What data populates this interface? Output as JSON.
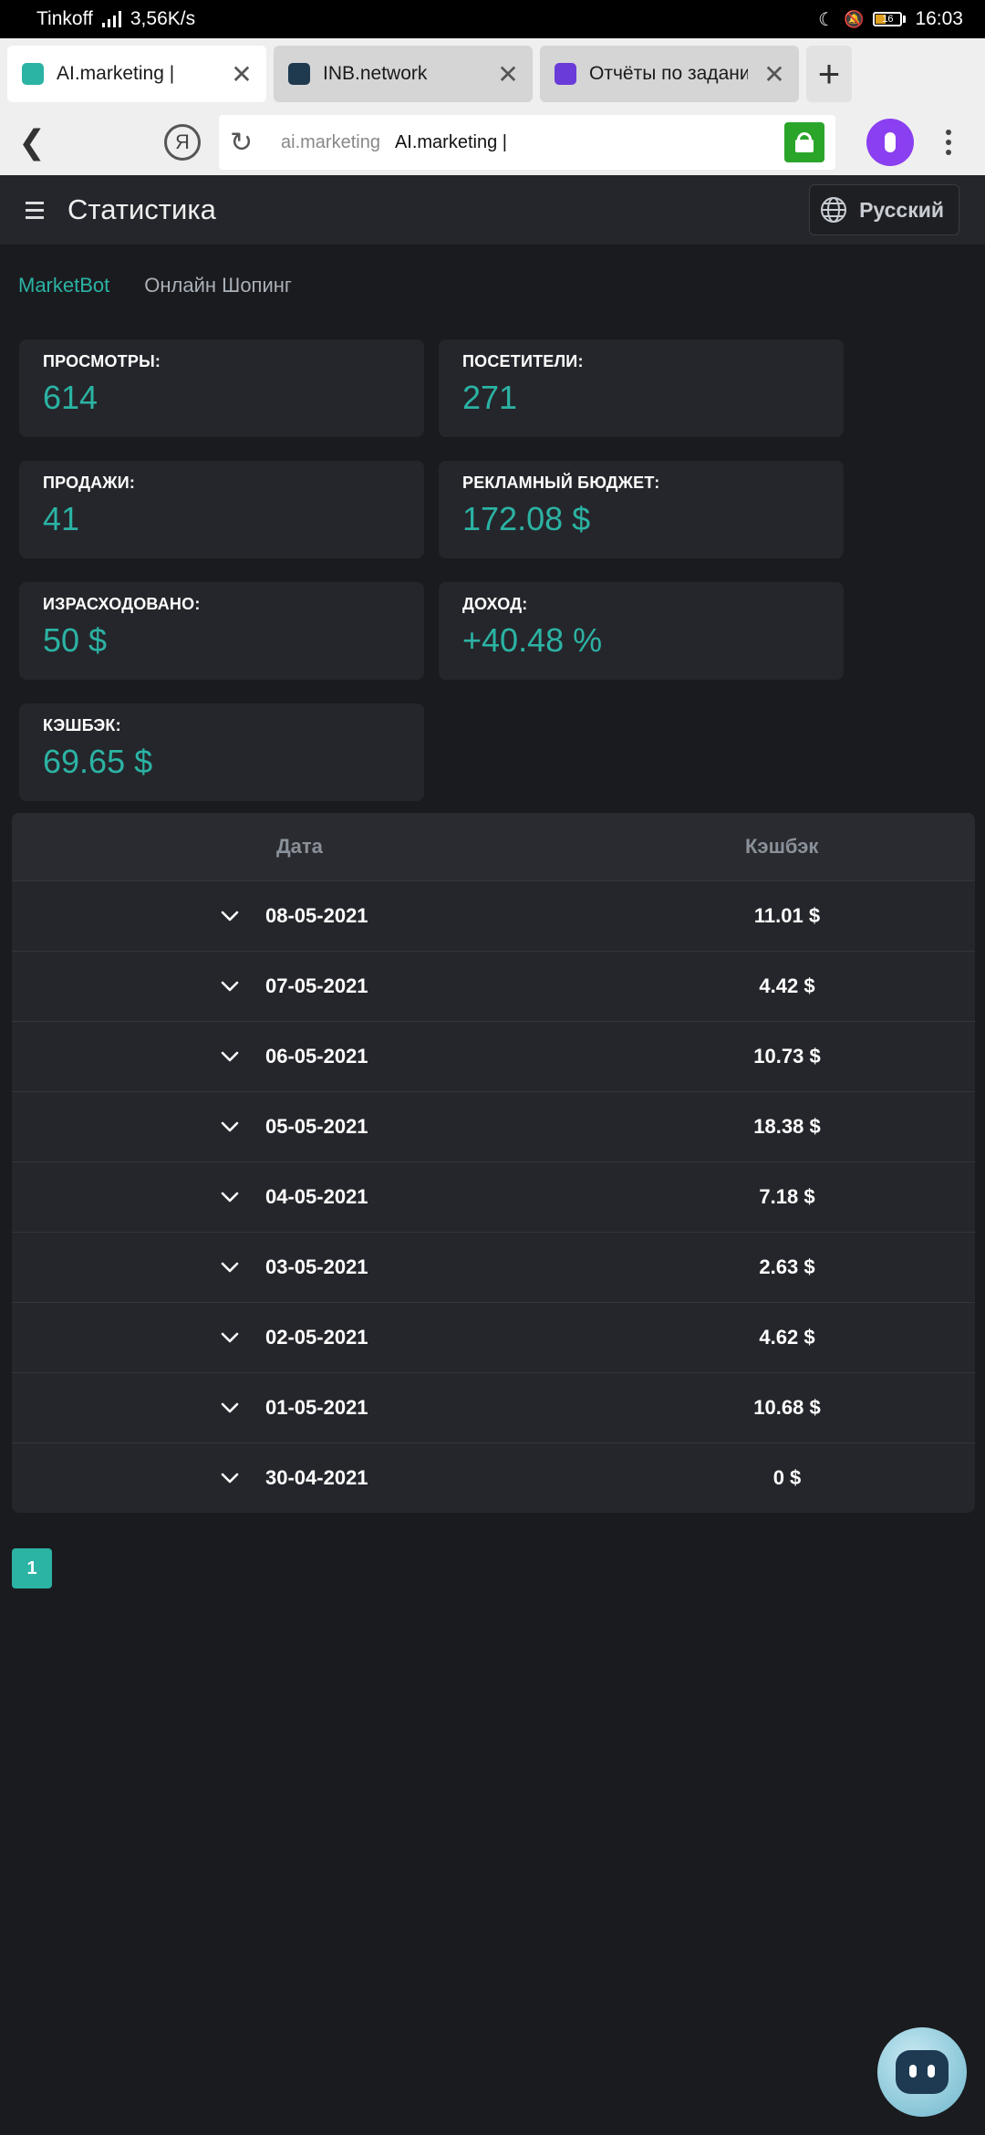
{
  "status_bar": {
    "carrier": "Tinkoff",
    "speed": "3,56K/s",
    "battery": "16",
    "time": "16:03"
  },
  "tabs": [
    {
      "title": "AI.marketing |",
      "favicon_color": "#2bb3a4"
    },
    {
      "title": "INB.network",
      "favicon_color": "#1f3a4f"
    },
    {
      "title": "Отчёты по задания",
      "favicon_color": "#6a3bd8"
    }
  ],
  "address_bar": {
    "logo": "Я",
    "domain": "ai.marketing",
    "page_title": "AI.marketing |"
  },
  "header": {
    "title": "Статистика",
    "language": "Русский"
  },
  "subnav": {
    "active": "MarketBot",
    "other": "Онлайн Шопинг"
  },
  "stats": {
    "views_label": "ПРОСМОТРЫ:",
    "views_value": "614",
    "visitors_label": "ПОСЕТИТЕЛИ:",
    "visitors_value": "271",
    "sales_label": "ПРОДАЖИ:",
    "sales_value": "41",
    "budget_label": "РЕКЛАМНЫЙ БЮДЖЕТ:",
    "budget_value": "172.08 $",
    "spent_label": "ИЗРАСХОДОВАНО:",
    "spent_value": "50 $",
    "income_label": "ДОХОД:",
    "income_value": "+40.48 %",
    "cashback_label": "КЭШБЭК:",
    "cashback_value": "69.65 $"
  },
  "table": {
    "col_date": "Дата",
    "col_cashback": "Кэшбэк",
    "rows": [
      {
        "date": "08-05-2021",
        "cashback": "11.01 $"
      },
      {
        "date": "07-05-2021",
        "cashback": "4.42 $"
      },
      {
        "date": "06-05-2021",
        "cashback": "10.73 $"
      },
      {
        "date": "05-05-2021",
        "cashback": "18.38 $"
      },
      {
        "date": "04-05-2021",
        "cashback": "7.18 $"
      },
      {
        "date": "03-05-2021",
        "cashback": "2.63 $"
      },
      {
        "date": "02-05-2021",
        "cashback": "4.62 $"
      },
      {
        "date": "01-05-2021",
        "cashback": "10.68 $"
      },
      {
        "date": "30-04-2021",
        "cashback": "0 $"
      }
    ]
  },
  "pagination": {
    "current": "1"
  },
  "colors": {
    "accent": "#2bb3a4",
    "background": "#1a1b1f",
    "card": "#25262b"
  }
}
